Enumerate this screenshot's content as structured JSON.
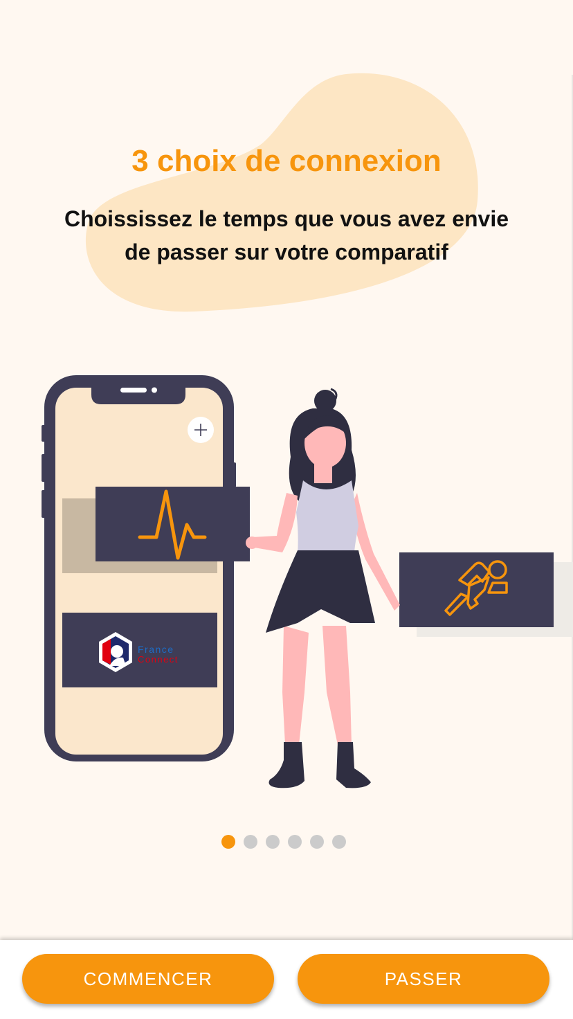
{
  "onboarding": {
    "title": "3 choix de connexion",
    "subtitle_line1": "Choississez le temps que vous avez envie",
    "subtitle_line2": "de passer sur votre comparatif"
  },
  "illustration": {
    "france_connect_line1": "France",
    "france_connect_line2": "Connect",
    "plus_icon": "plus-icon",
    "heartbeat_icon": "heartbeat-icon",
    "runner_icon": "runner-icon"
  },
  "pagination": {
    "total_pages": 6,
    "current_page": 1
  },
  "footer": {
    "start_label": "COMMENCER",
    "skip_label": "PASSER"
  },
  "colors": {
    "accent": "#f7950d",
    "background": "#fff8f1",
    "blob": "#fde6c4",
    "dark_card": "#3f3d56",
    "phone_screen": "#fbe7cc",
    "skin": "#ffb8b8"
  }
}
